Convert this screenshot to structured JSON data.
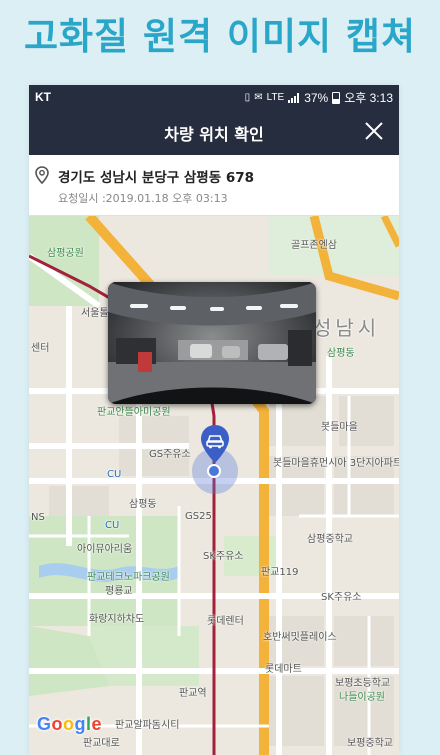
{
  "headline": "고화질 원격 이미지 캡쳐",
  "status_bar": {
    "carrier": "KT",
    "network": "LTE",
    "battery": "37%",
    "time": "오후 3:13"
  },
  "header": {
    "title": "차량 위치 확인",
    "close_icon": "close-icon"
  },
  "location": {
    "address": "경기도 성남시 분당구 삼평동 678",
    "request_time": "요청일시 :2019.01.18 오후 03:13"
  },
  "map": {
    "labels": {
      "sampyeong_park": "삼평공원",
      "seoul_tollgate": "서울톨",
      "golf_zone": "골프존엔삼",
      "seongnam": "성남시",
      "sampyeong_dong_top": "삼평동",
      "center": "센터",
      "pan_gwacheon": "판교안뜰아미공원",
      "gs_station_1": "GS주유소",
      "cu_1": "CU",
      "botdeul_village": "봇들마을",
      "botdeul_complex": "봇들마을휴먼시아 3단지아파트",
      "sampyeong_dong_mid": "삼평동",
      "gs25": "GS25",
      "ns": "NS",
      "cu_2": "CU",
      "aisik": "아이뮤아리움",
      "sampyeong_middle": "삼평중학교",
      "sk_station_1": "SK주유소",
      "pangyo_techno": "판교테크노파크공원",
      "pyeonglim": "평룡교",
      "pangyo_119": "판교119",
      "hwarang": "화랑지하차도",
      "sk_station_2": "SK주유소",
      "lotte_rental": "롯데렌터",
      "hyundai_plaza": "호반써밋플레이스",
      "lotte_mart": "롯데마트",
      "pangyo_station": "판교역",
      "boping": "보평초등학교",
      "naeul": "나들이공원",
      "alpha_city": "판교알파돔시티",
      "pangyo_road": "판교대로",
      "boping_middle": "보평중학교",
      "google": "Google"
    }
  },
  "colors": {
    "header_bg": "#262d3f",
    "headline": "#2aa7c8",
    "marker": "#3b5fc6"
  }
}
